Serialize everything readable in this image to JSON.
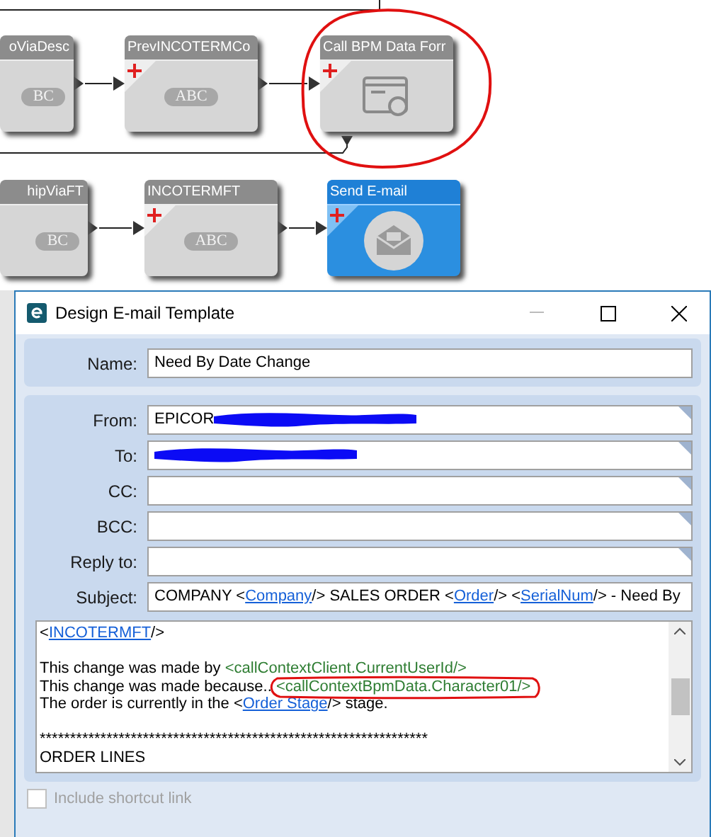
{
  "workflow": {
    "nodes": [
      {
        "title": "oViaDesc",
        "kind": "text",
        "selected": false,
        "badge": "BC"
      },
      {
        "title": "PrevINCOTERMCo",
        "kind": "text",
        "selected": false,
        "badge": "ABC"
      },
      {
        "title": "Call BPM Data Forr",
        "kind": "form",
        "selected": false
      },
      {
        "title": "hipViaFT",
        "kind": "text",
        "selected": false,
        "badge": "BC"
      },
      {
        "title": "INCOTERMFT",
        "kind": "text",
        "selected": false,
        "badge": "ABC"
      },
      {
        "title": "Send E-mail",
        "kind": "email",
        "selected": true
      }
    ]
  },
  "dialog": {
    "title": "Design E-mail Template",
    "name": {
      "label": "Name:",
      "value": "Need By Date Change"
    },
    "fields": [
      {
        "label": "From:",
        "value": "EPICOR",
        "redacted": true
      },
      {
        "label": "To:",
        "redacted": true
      },
      {
        "label": "CC:",
        "redacted": false
      },
      {
        "label": "BCC:",
        "redacted": false
      },
      {
        "label": "Reply to:",
        "redacted": false
      }
    ],
    "subject": {
      "label": "Subject:",
      "segments": [
        {
          "kind": "text",
          "text": "COMPANY <"
        },
        {
          "kind": "link",
          "text": "Company"
        },
        {
          "kind": "text",
          "text": "/> SALES ORDER <"
        },
        {
          "kind": "link",
          "text": "Order"
        },
        {
          "kind": "text",
          "text": "/> <"
        },
        {
          "kind": "link",
          "text": "SerialNum"
        },
        {
          "kind": "text",
          "text": "/> - Need By"
        }
      ]
    },
    "body": [
      {
        "blank_before": false,
        "segments": [
          {
            "kind": "text",
            "text": "<"
          },
          {
            "kind": "link",
            "text": "INCOTERMFT"
          },
          {
            "kind": "text",
            "text": "/>"
          }
        ]
      },
      {
        "blank_before": true,
        "segments": [
          {
            "kind": "text",
            "text": "This change was made by "
          },
          {
            "kind": "tag",
            "text": "<callContextClient.CurrentUserId/>",
            "circled": false
          }
        ]
      },
      {
        "blank_before": false,
        "segments": [
          {
            "kind": "text",
            "text": "This change was made because.. "
          },
          {
            "kind": "tag",
            "text": "<callContextBpmData.Character01/>",
            "circled": true
          }
        ]
      },
      {
        "blank_before": false,
        "segments": [
          {
            "kind": "text",
            "text": "The order is currently in the <"
          },
          {
            "kind": "link",
            "text": "Order Stage"
          },
          {
            "kind": "text",
            "text": "/> stage."
          }
        ]
      },
      {
        "blank_before": true,
        "segments": [
          {
            "kind": "text",
            "text": "****************************************************************"
          }
        ]
      },
      {
        "blank_before": false,
        "segments": [
          {
            "kind": "text",
            "text": "ORDER LINES"
          }
        ]
      }
    ],
    "shortcut": {
      "label": "Include shortcut link",
      "checked": false,
      "disabled": true
    }
  }
}
